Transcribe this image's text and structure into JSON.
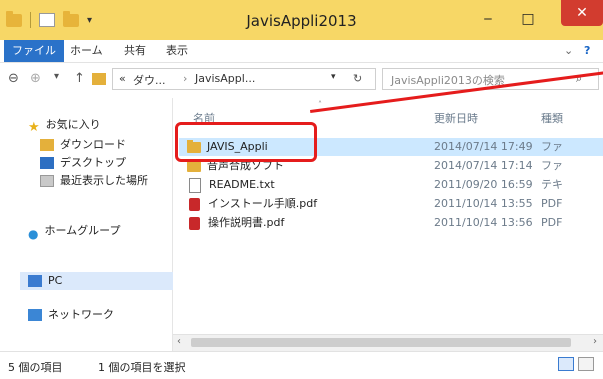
{
  "window": {
    "title": "JavisAppli2013"
  },
  "ribbon": {
    "tabs": [
      "ファイル",
      "ホーム",
      "共有",
      "表示"
    ]
  },
  "addressbar": {
    "path_prefix": "«",
    "path_segments": [
      "ダウ...",
      "JavisAppl..."
    ],
    "search_placeholder": "JavisAppli2013の検索"
  },
  "navpane": {
    "items": [
      {
        "label": "お気に入り",
        "icon": "star-icon"
      },
      {
        "label": "ダウンロード",
        "icon": "download-folder-icon"
      },
      {
        "label": "デスクトップ",
        "icon": "desktop-icon"
      },
      {
        "label": "最近表示した場所",
        "icon": "recent-places-icon"
      },
      {
        "label": "ホームグループ",
        "icon": "homegroup-icon"
      },
      {
        "label": "PC",
        "icon": "pc-icon"
      },
      {
        "label": "ネットワーク",
        "icon": "network-icon"
      }
    ]
  },
  "content": {
    "headers": {
      "name": "名前",
      "date": "更新日時",
      "type": "種類"
    },
    "files": [
      {
        "name": "JAVIS_Appli",
        "date": "2014/07/14 17:49",
        "type": "ファ",
        "icon": "folder-icon",
        "selected": true
      },
      {
        "name": "音声合成ソフト",
        "date": "2014/07/14 17:14",
        "type": "ファ",
        "icon": "folder-icon",
        "selected": false
      },
      {
        "name": "README.txt",
        "date": "2011/09/20 16:59",
        "type": "テキ",
        "icon": "text-file-icon",
        "selected": false
      },
      {
        "name": "インストール手順.pdf",
        "date": "2011/10/14 13:55",
        "type": "PDF",
        "icon": "pdf-icon",
        "selected": false
      },
      {
        "name": "操作説明書.pdf",
        "date": "2011/10/14 13:56",
        "type": "PDF",
        "icon": "pdf-icon",
        "selected": false
      }
    ]
  },
  "status": {
    "item_count": "5 個の項目",
    "selected_count": "1 個の項目を選択"
  },
  "colors": {
    "titlebar": "#f7d766",
    "file_tab": "#2a72c9",
    "selection": "#cce8ff",
    "annotation": "#e51c1c"
  }
}
